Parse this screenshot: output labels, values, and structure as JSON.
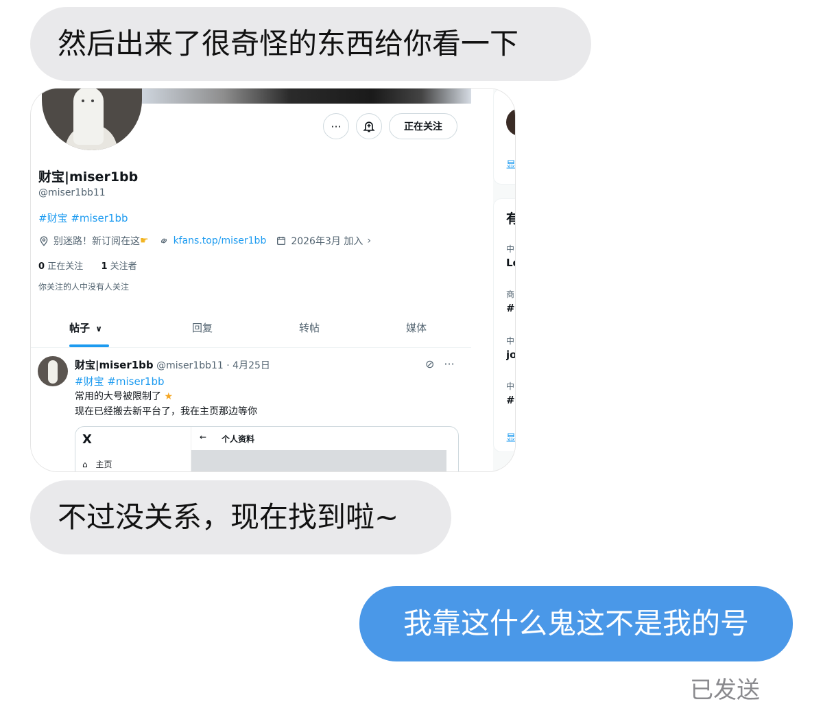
{
  "messages": {
    "received_1": "然后出来了很奇怪的东西给你看一下",
    "received_2": "不过没关系，现在找到啦~",
    "sent_1": "我靠这什么鬼这不是我的号",
    "status": "已发送"
  },
  "screenshot": {
    "profile": {
      "follow_button": "正在关注",
      "more_icon": "···",
      "name": "财宝|miser1bb",
      "handle": "@miser1bb11",
      "tags": "#财宝 #miser1bb",
      "location": "别迷路！新订阅在这",
      "link": "kfans.top/miser1bb",
      "joined": "2026年3月 加入",
      "following_count": "0",
      "following_label": "正在关注",
      "followers_count": "1",
      "followers_label": "关注者",
      "note": "你关注的人中没有人关注"
    },
    "tabs": [
      "帖子",
      "回复",
      "转帖",
      "媒体"
    ],
    "post": {
      "name": "财宝|miser1bb",
      "meta": "@miser1bb11 · 4月25日",
      "tags": "#财宝 #miser1bb",
      "line1": "常用的大号被限制了",
      "line2": "现在已经搬去新平台了，我在主页那边等你"
    },
    "embed": {
      "logo": "X",
      "home": "主页",
      "back": "←",
      "title": "个人资料"
    },
    "sidebar": {
      "show_1": "显",
      "heading": "有",
      "item_1_cat": "中",
      "item_1_title": "Lo",
      "item_2_cat": "商",
      "item_2_title": "#I",
      "item_3_cat": "中",
      "item_3_title": "jo",
      "item_4_cat": "中",
      "item_4_title": "#I",
      "show_2": "显"
    }
  }
}
